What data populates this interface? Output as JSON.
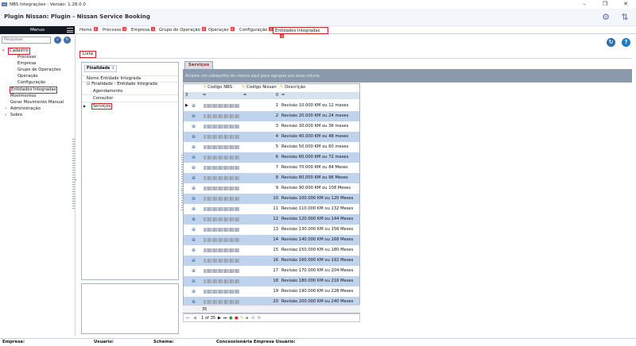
{
  "window": {
    "title": "NBS Integrações - Versão: 1.28.0.0",
    "app_title": "Plugin Nissan: Plugin - Nissan Service Booking"
  },
  "tabs": [
    {
      "label": "Home"
    },
    {
      "label": "Processo"
    },
    {
      "label": "Empresa"
    },
    {
      "label": "Grupo de Operação"
    },
    {
      "label": "Operação"
    },
    {
      "label": "Configuração"
    },
    {
      "label": "Entidades Integradas"
    }
  ],
  "menu": {
    "title": "Menus",
    "search_placeholder": "Pesquisar",
    "tree": [
      {
        "label": "Cadastro"
      },
      {
        "label": "Processo"
      },
      {
        "label": "Empresa"
      },
      {
        "label": "Grupo de Operações"
      },
      {
        "label": "Operação"
      },
      {
        "label": "Configuração"
      },
      {
        "label": "Entidades Integradas"
      },
      {
        "label": "Movimentos"
      },
      {
        "label": "Gerar Movimento Manual"
      },
      {
        "label": "Administração"
      },
      {
        "label": "Sobre"
      }
    ]
  },
  "lista_tab": "Lista",
  "finalidade": {
    "header": "Finalidade",
    "col_nome": "Nome Entidade Integrada",
    "group_label": "Finalidade : Entidade Integrada",
    "items": [
      "Agendamento",
      "Consultor",
      "Serviços"
    ]
  },
  "servicos": {
    "tab_label": "Serviços",
    "group_hint": "Arraste um cabeçalho de coluna aqui para agrupar por essa coluna",
    "columns": [
      "Código NBS",
      "Código Nissan",
      "Descrição"
    ],
    "filter_value": "0",
    "rows": [
      {
        "cnis": "1",
        "desc": "Revisão 10.000 KM ou 12 meses"
      },
      {
        "cnis": "2",
        "desc": "Revisão 20.000 KM ou 24 meses"
      },
      {
        "cnis": "3",
        "desc": "Revisão 30.000 KM ou 36 meses"
      },
      {
        "cnis": "4",
        "desc": "Revisão 40.000 KM ou 48 meses"
      },
      {
        "cnis": "5",
        "desc": "Revisão 50.000 KM ou 60 meses"
      },
      {
        "cnis": "6",
        "desc": "Revisão 60.000 KM ou 72 meses"
      },
      {
        "cnis": "7",
        "desc": "Revisão 70.000 KM ou 84 Meses"
      },
      {
        "cnis": "8",
        "desc": "Revisão 80.000 KM ou 96 Meses"
      },
      {
        "cnis": "9",
        "desc": "Revisão 90.000 KM ou 108 Meses"
      },
      {
        "cnis": "10",
        "desc": "Revisão 100.000 KM ou 120 Meses"
      },
      {
        "cnis": "11",
        "desc": "Revisão 110.000 KM ou 132 Meses"
      },
      {
        "cnis": "12",
        "desc": "Revisão 120.000 KM ou 144 Meses"
      },
      {
        "cnis": "13",
        "desc": "Revisão 130.000 KM ou 156 Meses"
      },
      {
        "cnis": "14",
        "desc": "Revisão 140.000 KM ou 168 Meses"
      },
      {
        "cnis": "15",
        "desc": "Revisão 150.000 KM ou 180 Meses"
      },
      {
        "cnis": "16",
        "desc": "Revisão 160.000 KM ou 192 Meses"
      },
      {
        "cnis": "17",
        "desc": "Revisão 170.000 KM ou 204 Meses"
      },
      {
        "cnis": "18",
        "desc": "Revisão 180.000 KM ou 216 Meses"
      },
      {
        "cnis": "19",
        "desc": "Revisão 190.000 KM ou 228 Meses"
      },
      {
        "cnis": "20",
        "desc": "Revisão 200.000 KM ou 240 Meses"
      }
    ],
    "footer_count": "35",
    "pager_text": "1 of 35"
  },
  "status": {
    "empresa": "Empresa:",
    "usuario": "Usuario:",
    "schema": "Schema:",
    "concessionaria": "Concessionária Empresa Usuário:"
  }
}
